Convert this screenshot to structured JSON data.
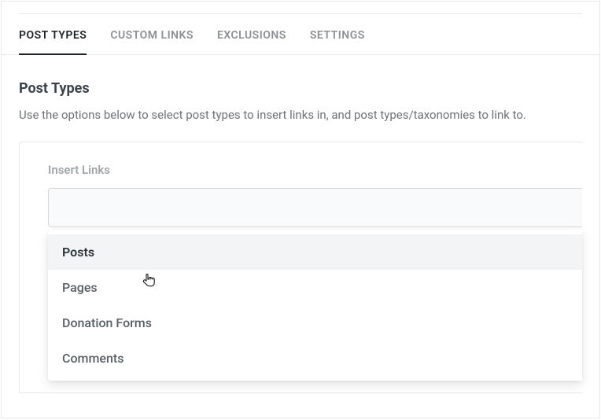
{
  "tabs": {
    "post_types": "POST TYPES",
    "custom_links": "CUSTOM LINKS",
    "exclusions": "EXCLUSIONS",
    "settings": "SETTINGS"
  },
  "section": {
    "title": "Post Types",
    "description": "Use the options below to select post types to insert links in, and post types/taxonomies to link to."
  },
  "field": {
    "label": "Insert Links"
  },
  "dropdown": {
    "items": [
      "Posts",
      "Pages",
      "Donation Forms",
      "Comments"
    ]
  }
}
